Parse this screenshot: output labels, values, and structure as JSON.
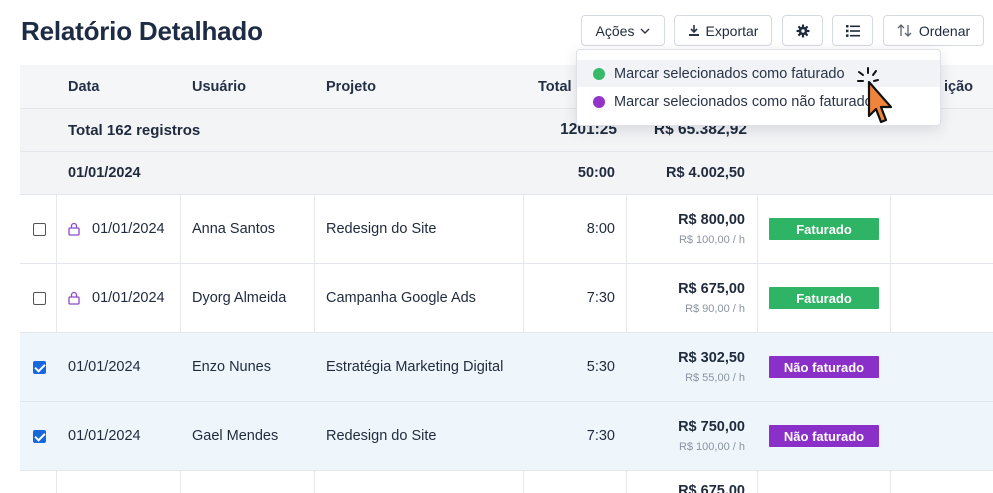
{
  "page": {
    "title": "Relatório Detalhado"
  },
  "toolbar": {
    "actions_label": "Ações",
    "export_label": "Exportar",
    "sort_label": "Ordenar"
  },
  "colors": {
    "billed": "#2fb466",
    "unbilled": "#8b2fc9",
    "dot_billed": "#37b96a",
    "dot_unbilled": "#9333c9"
  },
  "table": {
    "headers": {
      "date": "Data",
      "user": "Usuário",
      "project": "Projeto",
      "total": "Total h",
      "description": "ição"
    },
    "total_row": {
      "label": "Total 162 registros",
      "time": "1201:25",
      "amount": "R$ 65.382,92"
    },
    "group_row": {
      "date": "01/01/2024",
      "time": "50:00",
      "amount": "R$ 4.002,50"
    },
    "rows": [
      {
        "checked": false,
        "locked": true,
        "date": "01/01/2024",
        "user": "Anna Santos",
        "project": "Redesign do Site",
        "time": "8:00",
        "amount": "R$ 800,00",
        "rate": "R$ 100,00 / h",
        "status": "Faturado",
        "billed": true
      },
      {
        "checked": false,
        "locked": true,
        "date": "01/01/2024",
        "user": "Dyorg Almeida",
        "project": "Campanha Google Ads",
        "time": "7:30",
        "amount": "R$ 675,00",
        "rate": "R$ 90,00 / h",
        "status": "Faturado",
        "billed": true
      },
      {
        "checked": true,
        "locked": false,
        "date": "01/01/2024",
        "user": "Enzo Nunes",
        "project": "Estratégia Marketing Digital",
        "time": "5:30",
        "amount": "R$ 302,50",
        "rate": "R$ 55,00 / h",
        "status": "Não faturado",
        "billed": false
      },
      {
        "checked": true,
        "locked": false,
        "date": "01/01/2024",
        "user": "Gael Mendes",
        "project": "Redesign do Site",
        "time": "7:30",
        "amount": "R$ 750,00",
        "rate": "R$ 100,00 / h",
        "status": "Não faturado",
        "billed": false
      }
    ],
    "partial_row": {
      "amount": "R$ 675,00"
    }
  },
  "dropdown": {
    "items": [
      {
        "label": "Marcar selecionados como faturado"
      },
      {
        "label": "Marcar selecionados como não faturado"
      }
    ]
  },
  "icons": {
    "actions": "chevron-down-icon",
    "export": "download-icon",
    "settings": "gear-icon",
    "columns": "list-icon",
    "sort": "sort-arrows-icon",
    "row_lock": "lock-icon",
    "cursor": "pointer-hand-icon"
  }
}
